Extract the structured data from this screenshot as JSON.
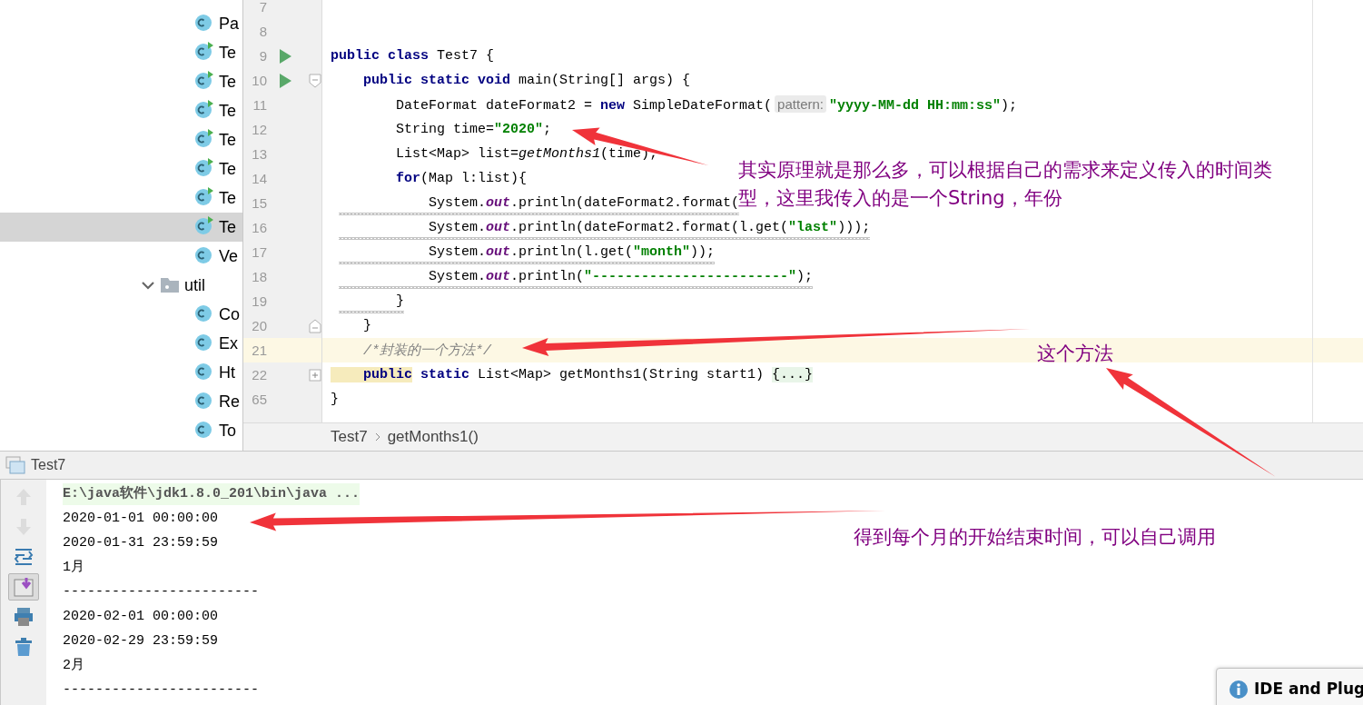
{
  "project_tree": [
    {
      "kind": "class",
      "name": "Pa",
      "runnable": false,
      "selected": false
    },
    {
      "kind": "class",
      "name": "Te",
      "runnable": true,
      "selected": false
    },
    {
      "kind": "class",
      "name": "Te",
      "runnable": true,
      "selected": false
    },
    {
      "kind": "class",
      "name": "Te",
      "runnable": true,
      "selected": false
    },
    {
      "kind": "class",
      "name": "Te",
      "runnable": true,
      "selected": false
    },
    {
      "kind": "class",
      "name": "Te",
      "runnable": true,
      "selected": false
    },
    {
      "kind": "class",
      "name": "Te",
      "runnable": true,
      "selected": false
    },
    {
      "kind": "class",
      "name": "Te",
      "runnable": true,
      "selected": true
    },
    {
      "kind": "class",
      "name": "Ve",
      "runnable": false,
      "selected": false
    },
    {
      "kind": "folder",
      "name": "util",
      "expanded": true,
      "children": [
        {
          "kind": "class",
          "name": "Co",
          "runnable": false,
          "selected": false
        },
        {
          "kind": "class",
          "name": "Ex",
          "runnable": false,
          "selected": false
        },
        {
          "kind": "class",
          "name": "Ht",
          "runnable": false,
          "selected": false
        },
        {
          "kind": "class",
          "name": "Re",
          "runnable": false,
          "selected": false
        },
        {
          "kind": "class",
          "name": "To",
          "runnable": false,
          "selected": false
        }
      ]
    }
  ],
  "editor": {
    "lines": [
      {
        "number": "7",
        "run": false,
        "current": false,
        "warning": false
      },
      {
        "number": "8",
        "run": false,
        "current": false,
        "warning": false
      },
      {
        "number": "9",
        "run": true,
        "current": false,
        "warning": false,
        "tokens": [
          {
            "kind": "keyword",
            "text": "public class"
          },
          {
            "kind": "plain",
            "text": " Test7 {"
          }
        ]
      },
      {
        "number": "10",
        "run": true,
        "fold": {
          "kind": "start"
        },
        "current": false,
        "warning": false,
        "tokens": [
          {
            "kind": "keyword",
            "text": "    public static void"
          },
          {
            "kind": "plain",
            "text": " main(String[] args) {"
          }
        ]
      },
      {
        "number": "11",
        "run": false,
        "current": false,
        "warning": false,
        "tokens": [
          {
            "kind": "plain",
            "text": "        DateFormat dateFormat2 = "
          },
          {
            "kind": "keyword",
            "text": "new"
          },
          {
            "kind": "plain",
            "text": " SimpleDateFormat("
          },
          {
            "kind": "hint",
            "text": "pattern:"
          },
          {
            "kind": "string",
            "text": "\"yyyy-MM-dd HH:mm:ss\""
          },
          {
            "kind": "plain",
            "text": ");"
          }
        ]
      },
      {
        "number": "12",
        "run": false,
        "current": false,
        "warning": false,
        "tokens": [
          {
            "kind": "plain",
            "text": "        String time="
          },
          {
            "kind": "string",
            "text": "\"2020\""
          },
          {
            "kind": "plain",
            "text": ";"
          }
        ]
      },
      {
        "number": "13",
        "run": false,
        "current": false,
        "warning": false,
        "tokens": [
          {
            "kind": "plain",
            "text": "        List<Map> list="
          },
          {
            "kind": "method",
            "text": "getMonths1"
          },
          {
            "kind": "plain",
            "text": "(time);"
          }
        ]
      },
      {
        "number": "14",
        "run": false,
        "current": false,
        "warning": false,
        "tokens": [
          {
            "kind": "keyword",
            "text": "        for"
          },
          {
            "kind": "plain",
            "text": "(Map l:list){"
          }
        ]
      },
      {
        "number": "15",
        "run": false,
        "current": false,
        "warning": true,
        "tokens": [
          {
            "kind": "plain",
            "text": "            System."
          },
          {
            "kind": "field",
            "text": "out"
          },
          {
            "kind": "plain",
            "text": ".println(dateFormat2.format("
          }
        ]
      },
      {
        "number": "16",
        "run": false,
        "current": false,
        "warning": true,
        "tokens": [
          {
            "kind": "plain",
            "text": "            System."
          },
          {
            "kind": "field",
            "text": "out"
          },
          {
            "kind": "plain",
            "text": ".println(dateFormat2.format(l.get("
          },
          {
            "kind": "string",
            "text": "\"last\""
          },
          {
            "kind": "plain",
            "text": ")));"
          }
        ]
      },
      {
        "number": "17",
        "run": false,
        "current": false,
        "warning": true,
        "tokens": [
          {
            "kind": "plain",
            "text": "            System."
          },
          {
            "kind": "field",
            "text": "out"
          },
          {
            "kind": "plain",
            "text": ".println(l.get("
          },
          {
            "kind": "string",
            "text": "\"month\""
          },
          {
            "kind": "plain",
            "text": "));"
          }
        ]
      },
      {
        "number": "18",
        "run": false,
        "current": false,
        "warning": true,
        "tokens": [
          {
            "kind": "plain",
            "text": "            System."
          },
          {
            "kind": "field",
            "text": "out"
          },
          {
            "kind": "plain",
            "text": ".println("
          },
          {
            "kind": "string",
            "text": "\"------------------------\""
          },
          {
            "kind": "plain",
            "text": ");"
          }
        ]
      },
      {
        "number": "19",
        "run": false,
        "current": false,
        "warning": true,
        "tokens": [
          {
            "kind": "plain",
            "text": "        }"
          }
        ]
      },
      {
        "number": "20",
        "run": false,
        "fold": {
          "kind": "end"
        },
        "current": false,
        "warning": false,
        "tokens": [
          {
            "kind": "plain",
            "text": "    }"
          }
        ]
      },
      {
        "number": "21",
        "run": false,
        "current": true,
        "warning": false,
        "tokens": [
          {
            "kind": "comment",
            "text": "    /*封装的一个方法*/"
          }
        ]
      },
      {
        "number": "22",
        "run": false,
        "fold": {
          "kind": "collapsed"
        },
        "current": false,
        "warning": false,
        "tokens": [
          {
            "kind": "keyword_marked",
            "text": "    public"
          },
          {
            "kind": "keyword",
            "text": " static"
          },
          {
            "kind": "plain",
            "text": " List<Map> getMonths1(String start1) "
          },
          {
            "kind": "folded",
            "text": "{...}"
          }
        ]
      },
      {
        "number": "65",
        "run": false,
        "current": false,
        "warning": false,
        "tokens": [
          {
            "kind": "plain",
            "text": "}"
          }
        ]
      }
    ]
  },
  "breadcrumb": [
    "Test7",
    "getMonths1()"
  ],
  "run_panel": {
    "title": "Test7",
    "toolbar": [
      {
        "kind": "up",
        "disabled": true,
        "selected": false
      },
      {
        "kind": "down",
        "disabled": true,
        "selected": false
      },
      {
        "kind": "wrap",
        "disabled": false,
        "selected": false
      },
      {
        "kind": "scroll_end",
        "disabled": false,
        "selected": true
      },
      {
        "kind": "print",
        "disabled": false,
        "selected": false
      },
      {
        "kind": "clear",
        "disabled": false,
        "selected": false
      }
    ],
    "console": [
      {
        "kind": "command",
        "text": "E:\\java软件\\jdk1.8.0_201\\bin\\java ..."
      },
      {
        "kind": "output",
        "text": "2020-01-01 00:00:00"
      },
      {
        "kind": "output",
        "text": "2020-01-31 23:59:59"
      },
      {
        "kind": "output",
        "text": "1月"
      },
      {
        "kind": "output",
        "text": "------------------------"
      },
      {
        "kind": "output",
        "text": "2020-02-01 00:00:00"
      },
      {
        "kind": "output",
        "text": "2020-02-29 23:59:59"
      },
      {
        "kind": "output",
        "text": "2月"
      },
      {
        "kind": "output",
        "text": "------------------------"
      }
    ]
  },
  "annotations": [
    {
      "lines": [
        "其实原理就是那么多，可以根据自己的需求来定义传入的时间类",
        "型，这里我传入的是一个String，年份"
      ]
    },
    {
      "lines": [
        "这个方法"
      ]
    },
    {
      "lines": [
        "得到每个月的开始结束时间，可以自己调用"
      ]
    }
  ],
  "notification": {
    "title": "IDE and Plug"
  }
}
